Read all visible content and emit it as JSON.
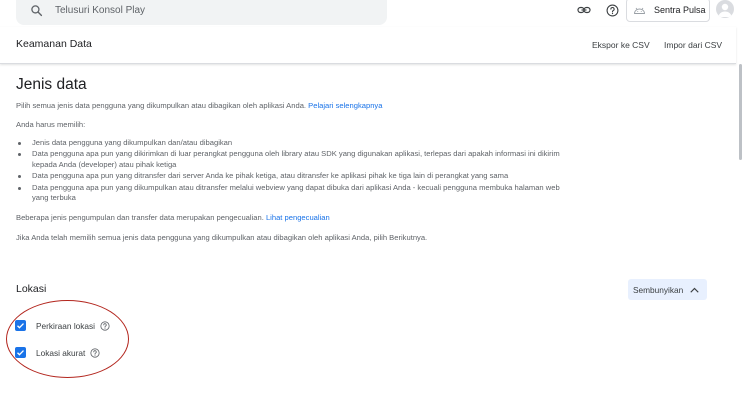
{
  "search": {
    "placeholder": "Telusuri Konsol Play"
  },
  "topbar": {
    "developer_name": "Sentra Pulsa"
  },
  "header": {
    "title": "Keamanan Data",
    "export_label": "Ekspor ke CSV",
    "import_label": "Impor dari CSV"
  },
  "main": {
    "heading": "Jenis data",
    "intro": "Pilih semua jenis data pengguna yang dikumpulkan atau dibagikan oleh aplikasi Anda.",
    "learn_more": "Pelajari selengkapnya",
    "must_choose": "Anda harus memilih:",
    "bullets": [
      "Jenis data pengguna yang dikumpulkan dan/atau dibagikan",
      "Data pengguna apa pun yang dikirimkan di luar perangkat pengguna oleh library atau SDK yang digunakan aplikasi, terlepas dari apakah informasi ini dikirim kepada Anda (developer) atau pihak ketiga",
      "Data pengguna apa pun yang ditransfer dari server Anda ke pihak ketiga, atau ditransfer ke aplikasi pihak ke tiga lain di perangkat yang sama",
      "Data pengguna apa pun yang dikumpulkan atau ditransfer melalui webview yang dapat dibuka dari aplikasi Anda - kecuali pengguna membuka halaman web yang terbuka"
    ],
    "exceptions_text": "Beberapa jenis pengumpulan dan transfer data merupakan pengecualian.",
    "exceptions_link": "Lihat pengecualian",
    "next_text": "Jika Anda telah memilih semua jenis data pengguna yang dikumpulkan atau dibagikan oleh aplikasi Anda, pilih Berikutnya."
  },
  "location": {
    "title": "Lokasi",
    "toggle_label": "Sembunyikan",
    "items": [
      {
        "label": "Perkiraan lokasi",
        "checked": true
      },
      {
        "label": "Lokasi akurat",
        "checked": true
      }
    ]
  },
  "colors": {
    "accent": "#1a73e8",
    "annotation": "#b3261e",
    "hide_button_bg": "#e8f0fe"
  }
}
